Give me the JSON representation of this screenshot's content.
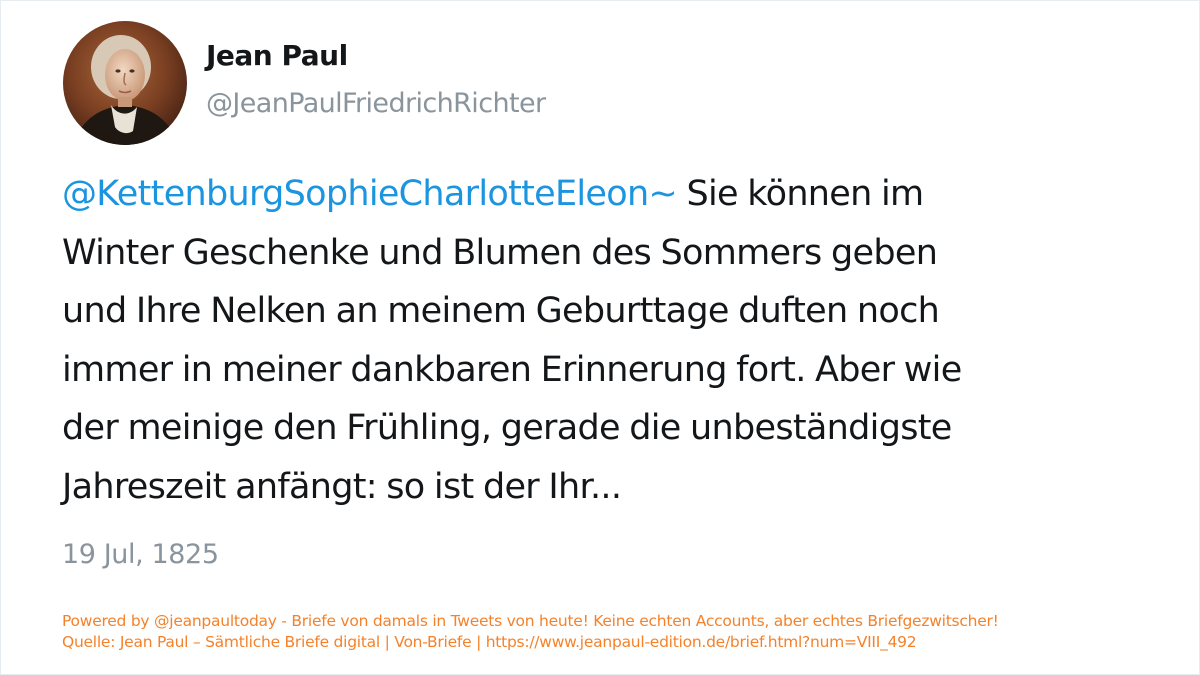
{
  "author": {
    "name": "Jean Paul",
    "handle": "@JeanPaulFriedrichRichter",
    "avatar_icon": "portrait-avatar-icon"
  },
  "tweet": {
    "mention": "@KettenburgSophieCharlotteEleon~",
    "lines": [
      " Sie können im",
      "Winter Geschenke und Blumen des Sommers geben",
      "und Ihre Nelken an meinem Geburttage duften noch",
      "immer in meiner dankbaren Erinnerung fort. Aber wie",
      "der meinige den Frühling, gerade die unbeständigste",
      "Jahreszeit anfängt: so ist der Ihr..."
    ],
    "date": "19 Jul, 1825"
  },
  "footer": {
    "line1": "Powered by @jeanpaultoday - Briefe von damals in Tweets von heute! Keine echten Accounts, aber echtes Briefgezwitscher!",
    "line2": "Quelle: Jean Paul – Sämtliche Briefe digital | Von-Briefe | https://www.jeanpaul-edition.de/brief.html?num=VIII_492"
  },
  "colors": {
    "text": "#14171a",
    "mention": "#1b95e0",
    "muted": "#8a949c",
    "footer": "#f5822b",
    "border": "#e6ecf0"
  }
}
